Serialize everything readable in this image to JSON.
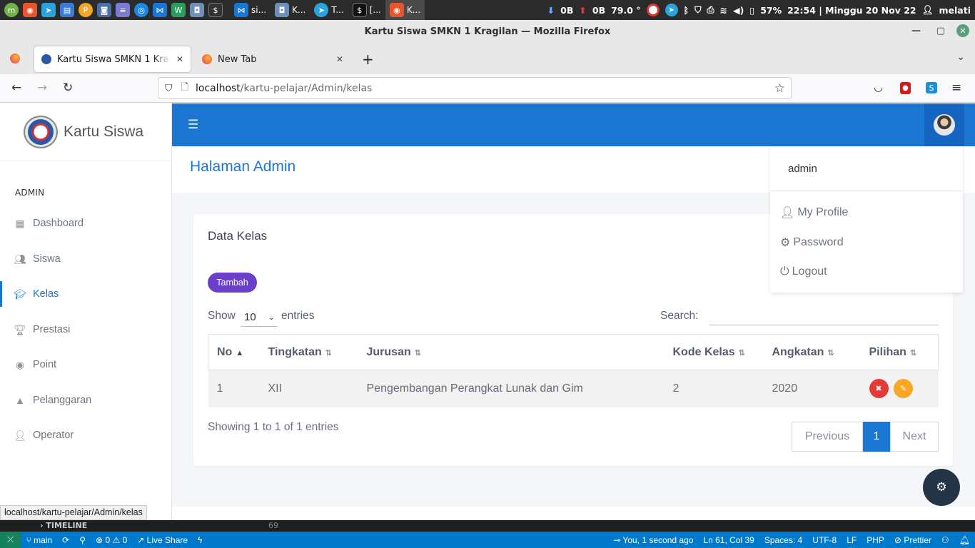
{
  "system_panel": {
    "tasks": [
      {
        "label": "si...",
        "active": false
      },
      {
        "label": "K...",
        "active": false
      },
      {
        "label": "T...",
        "active": false
      },
      {
        "label": "[...",
        "active": false
      },
      {
        "label": "K...",
        "active": true
      }
    ],
    "net_down": "0B",
    "net_up": "0B",
    "temperature": "79.0 °",
    "battery": "57%",
    "datetime": "22:54 | Minggu 20 Nov 22",
    "user": "melati"
  },
  "window": {
    "title": "Kartu Siswa SMKN 1 Kragilan — Mozilla Firefox"
  },
  "tabs": [
    {
      "label": "Kartu Siswa SMKN 1 Kragilan",
      "active": true
    },
    {
      "label": "New Tab",
      "active": false
    }
  ],
  "url": {
    "host": "localhost",
    "path": "/kartu-pelajar/Admin/kelas"
  },
  "sidebar": {
    "brand": "Kartu Siswa",
    "section": "ADMIN",
    "items": [
      {
        "label": "Dashboard",
        "icon": "dashboard-icon",
        "active": false
      },
      {
        "label": "Siswa",
        "icon": "users-icon",
        "active": false
      },
      {
        "label": "Kelas",
        "icon": "graduation-cap-icon",
        "active": true
      },
      {
        "label": "Prestasi",
        "icon": "trophy-icon",
        "active": false
      },
      {
        "label": "Point",
        "icon": "circle-dot-icon",
        "active": false
      },
      {
        "label": "Pelanggaran",
        "icon": "warning-icon",
        "active": false
      },
      {
        "label": "Operator",
        "icon": "person-icon",
        "active": false
      }
    ]
  },
  "header": {
    "page_title": "Halaman Admin"
  },
  "dropdown": {
    "username": "admin",
    "items": [
      {
        "label": "My Profile",
        "icon": "user-icon"
      },
      {
        "label": "Password",
        "icon": "gear-icon"
      },
      {
        "label": "Logout",
        "icon": "power-icon"
      }
    ]
  },
  "card": {
    "title": "Data Kelas",
    "add_button": "Tambah",
    "show_label": "Show",
    "entries_label": "entries",
    "page_length": "10",
    "search_label": "Search:",
    "columns": [
      "No",
      "Tingkatan",
      "Jurusan",
      "Kode Kelas",
      "Angkatan",
      "Pilihan"
    ],
    "rows": [
      {
        "no": "1",
        "tingkatan": "XII",
        "jurusan": "Pengembangan Perangkat Lunak dan Gim",
        "kode_kelas": "2",
        "angkatan": "2020"
      }
    ],
    "info": "Showing 1 to 1 of 1 entries",
    "pagination": {
      "previous": "Previous",
      "current": "1",
      "next": "Next"
    }
  },
  "status_url": "localhost/kartu-pelajar/Admin/kelas",
  "vscode": {
    "timeline_label": "TIMELINE",
    "line_number": "69",
    "branch": "main",
    "problems_errors": "0",
    "problems_warnings": "0",
    "live_share": "Live Share",
    "blame": "You, 1 second ago",
    "cursor": "Ln 61, Col 39",
    "spaces": "Spaces: 4",
    "encoding": "UTF-8",
    "eol": "LF",
    "language": "PHP",
    "formatter": "Prettier"
  },
  "colors": {
    "primary": "#1b76d2",
    "tambah": "#6a3fc9",
    "delete": "#e53935",
    "edit": "#f9a825",
    "vscode_status": "#007acc"
  }
}
